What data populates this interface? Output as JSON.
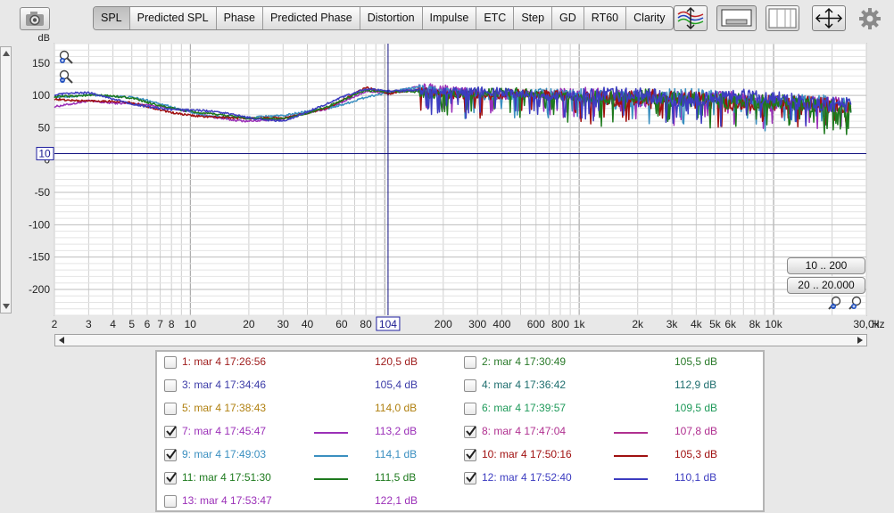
{
  "tabs": [
    {
      "label": "SPL",
      "active": true
    },
    {
      "label": "Predicted SPL",
      "active": false
    },
    {
      "label": "Phase",
      "active": false
    },
    {
      "label": "Predicted Phase",
      "active": false
    },
    {
      "label": "Distortion",
      "active": false
    },
    {
      "label": "Impulse",
      "active": false
    },
    {
      "label": "ETC",
      "active": false
    },
    {
      "label": "Step",
      "active": false
    },
    {
      "label": "GD",
      "active": false
    },
    {
      "label": "RT60",
      "active": false
    },
    {
      "label": "Clarity",
      "active": false
    }
  ],
  "toolbar_icons": [
    "camera-icon",
    "y-axis-limits-icon",
    "controls-icon",
    "window-layout-icon",
    "x-axis-limits-icon",
    "gear-icon"
  ],
  "range_buttons": {
    "low": "10 .. 200",
    "high": "20 .. 20.000"
  },
  "cursor": {
    "x_label": "104",
    "y_label": "10"
  },
  "chart_data": {
    "type": "line",
    "ylabel": "dB",
    "xunit": "Hz",
    "xscale": "log",
    "xlim": [
      2,
      30000
    ],
    "ylim": [
      -240,
      180
    ],
    "yticks": [
      150,
      100,
      50,
      0,
      -50,
      -100,
      -150,
      -200
    ],
    "xticks": [
      {
        "v": 2,
        "label": "2"
      },
      {
        "v": 3,
        "label": "3"
      },
      {
        "v": 4,
        "label": "4"
      },
      {
        "v": 5,
        "label": "5"
      },
      {
        "v": 6,
        "label": "6"
      },
      {
        "v": 7,
        "label": "7"
      },
      {
        "v": 8,
        "label": "8"
      },
      {
        "v": 10,
        "label": "10"
      },
      {
        "v": 20,
        "label": "20"
      },
      {
        "v": 30,
        "label": "30"
      },
      {
        "v": 40,
        "label": "40"
      },
      {
        "v": 60,
        "label": "60"
      },
      {
        "v": 80,
        "label": "80"
      },
      {
        "v": 200,
        "label": "200"
      },
      {
        "v": 300,
        "label": "300"
      },
      {
        "v": 400,
        "label": "400"
      },
      {
        "v": 600,
        "label": "600"
      },
      {
        "v": 800,
        "label": "800"
      },
      {
        "v": 1000,
        "label": "1k"
      },
      {
        "v": 2000,
        "label": "2k"
      },
      {
        "v": 3000,
        "label": "3k"
      },
      {
        "v": 4000,
        "label": "4k"
      },
      {
        "v": 5000,
        "label": "5k"
      },
      {
        "v": 6000,
        "label": "6k"
      },
      {
        "v": 8000,
        "label": "8k"
      },
      {
        "v": 10000,
        "label": "10k"
      },
      {
        "v": 30000,
        "label": "30,0k"
      }
    ],
    "grid": true,
    "cursor": {
      "x": 104,
      "y": 10
    },
    "series": [
      {
        "name": "7: mar 4 17:45:47",
        "color": "#9b30b8",
        "points": [
          [
            2,
            82
          ],
          [
            3,
            95
          ],
          [
            5,
            88
          ],
          [
            8,
            78
          ],
          [
            12,
            70
          ],
          [
            20,
            63
          ],
          [
            30,
            62
          ],
          [
            50,
            78
          ],
          [
            80,
            110
          ],
          [
            104,
            107
          ],
          [
            150,
            112
          ],
          [
            300,
            106
          ],
          [
            1000,
            104
          ],
          [
            5000,
            100
          ],
          [
            25000,
            88
          ]
        ]
      },
      {
        "name": "9: mar 4 17:49:03",
        "color": "#3a8fc0",
        "points": [
          [
            2,
            100
          ],
          [
            3,
            104
          ],
          [
            5,
            95
          ],
          [
            8,
            82
          ],
          [
            12,
            72
          ],
          [
            20,
            66
          ],
          [
            30,
            66
          ],
          [
            50,
            82
          ],
          [
            80,
            100
          ],
          [
            104,
            104
          ],
          [
            150,
            110
          ],
          [
            300,
            105
          ],
          [
            1000,
            103
          ],
          [
            5000,
            100
          ],
          [
            25000,
            88
          ]
        ]
      },
      {
        "name": "10: mar 4 17:50:16",
        "color": "#a01010",
        "points": [
          [
            2,
            98
          ],
          [
            3,
            92
          ],
          [
            5,
            86
          ],
          [
            8,
            76
          ],
          [
            12,
            70
          ],
          [
            20,
            62
          ],
          [
            30,
            64
          ],
          [
            50,
            84
          ],
          [
            80,
            112
          ],
          [
            104,
            100
          ],
          [
            150,
            108
          ],
          [
            300,
            104
          ],
          [
            1000,
            102
          ],
          [
            5000,
            98
          ],
          [
            25000,
            85
          ]
        ]
      },
      {
        "name": "11: mar 4 17:51:30",
        "color": "#1e7a1e",
        "points": [
          [
            2,
            100
          ],
          [
            3,
            98
          ],
          [
            5,
            96
          ],
          [
            8,
            84
          ],
          [
            12,
            72
          ],
          [
            20,
            62
          ],
          [
            30,
            66
          ],
          [
            50,
            84
          ],
          [
            80,
            105
          ],
          [
            104,
            104
          ],
          [
            150,
            108
          ],
          [
            300,
            106
          ],
          [
            1000,
            103
          ],
          [
            5000,
            99
          ],
          [
            25000,
            86
          ]
        ]
      },
      {
        "name": "12: mar 4 17:52:40",
        "color": "#3c3cc0",
        "points": [
          [
            2,
            100
          ],
          [
            3,
            102
          ],
          [
            5,
            90
          ],
          [
            8,
            80
          ],
          [
            12,
            74
          ],
          [
            20,
            66
          ],
          [
            30,
            64
          ],
          [
            50,
            86
          ],
          [
            80,
            108
          ],
          [
            104,
            108
          ],
          [
            150,
            112
          ],
          [
            300,
            106
          ],
          [
            1000,
            104
          ],
          [
            5000,
            102
          ],
          [
            25000,
            92
          ]
        ]
      }
    ]
  },
  "legend": [
    {
      "label": "1: mar 4 17:26:56",
      "value": "120,5 dB",
      "color": "#a02020",
      "checked": false
    },
    {
      "label": "2: mar 4 17:30:49",
      "value": "105,5 dB",
      "color": "#2a7a2a",
      "checked": false
    },
    {
      "label": "3: mar 4 17:34:46",
      "value": "105,4 dB",
      "color": "#3c3ca8",
      "checked": false
    },
    {
      "label": "4: mar 4 17:36:42",
      "value": "112,9 dB",
      "color": "#1e6e6e",
      "checked": false
    },
    {
      "label": "5: mar 4 17:38:43",
      "value": "114,0 dB",
      "color": "#b08010",
      "checked": false
    },
    {
      "label": "6: mar 4 17:39:57",
      "value": "109,5 dB",
      "color": "#1f9a5a",
      "checked": false
    },
    {
      "label": "7: mar 4 17:45:47",
      "value": "113,2 dB",
      "color": "#9b30b8",
      "checked": true
    },
    {
      "label": "8: mar 4 17:47:04",
      "value": "107,8 dB",
      "color": "#b03090",
      "checked": true
    },
    {
      "label": "9: mar 4 17:49:03",
      "value": "114,1 dB",
      "color": "#3a8fc0",
      "checked": true
    },
    {
      "label": "10: mar 4 17:50:16",
      "value": "105,3 dB",
      "color": "#a01010",
      "checked": true
    },
    {
      "label": "11: mar 4 17:51:30",
      "value": "111,5 dB",
      "color": "#1e7a1e",
      "checked": true
    },
    {
      "label": "12: mar 4 17:52:40",
      "value": "110,1 dB",
      "color": "#3c3cc0",
      "checked": true
    },
    {
      "label": "13: mar 4 17:53:47",
      "value": "122,1 dB",
      "color": "#9b30b8",
      "checked": false
    }
  ]
}
